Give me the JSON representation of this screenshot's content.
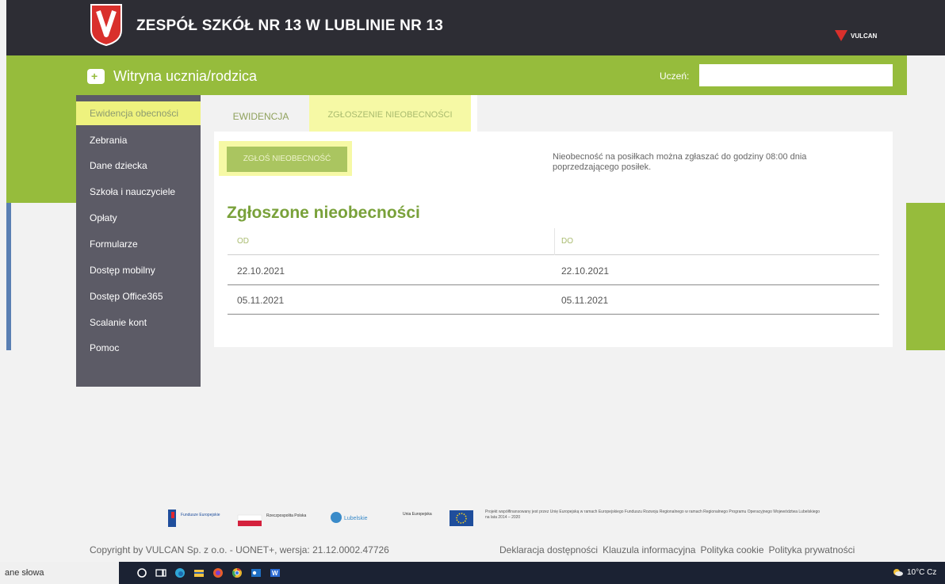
{
  "header": {
    "school_name": "ZESPÓŁ SZKÓŁ NR 13 W LUBLINIE NR 13",
    "vulcan_label": "VULCAN",
    "portal_title": "Witryna ucznia/rodzica",
    "student_label": "Uczeń:",
    "student_value": ""
  },
  "sidebar": {
    "items": [
      {
        "label": "Ewidencja obecności"
      },
      {
        "label": "Zebrania"
      },
      {
        "label": "Dane dziecka"
      },
      {
        "label": "Szkoła i nauczyciele"
      },
      {
        "label": "Opłaty"
      },
      {
        "label": "Formularze"
      },
      {
        "label": "Dostęp mobilny"
      },
      {
        "label": "Dostęp Office365"
      },
      {
        "label": "Scalanie kont"
      },
      {
        "label": "Pomoc"
      }
    ]
  },
  "tabs": [
    {
      "label": "EWIDENCJA"
    },
    {
      "label": "ZGŁOSZENIE NIEOBECNOŚCI"
    }
  ],
  "main": {
    "report_button": "ZGŁOŚ NIEOBECNOŚĆ",
    "meal_info": "Nieobecność na posiłkach można zgłaszać do godziny 08:00 dnia poprzedzającego posiłek.",
    "list_title": "Zgłoszone nieobecności",
    "table": {
      "headers": [
        "OD",
        "DO"
      ],
      "rows": [
        [
          "22.10.2021",
          "22.10.2021"
        ],
        [
          "05.11.2021",
          "05.11.2021"
        ]
      ]
    }
  },
  "footer": {
    "logos": {
      "fe": "Fundusze Europejskie",
      "rp": "Rzeczpospolita Polska",
      "lubelskie": "Lubelskie",
      "ue": "Unia Europejska"
    },
    "project_note": "Projekt współfinansowany jest przez Unię Europejską w ramach Europejskiego Funduszu Rozwoju Regionalnego w ramach Regionalnego Programu Operacyjnego Województwa Lubelskiego na lata 2014 – 2020",
    "copyright": "Copyright by VULCAN Sp. z o.o. - UONET+, wersja: 21.12.0002.47726",
    "links": [
      "Deklaracja dostępności",
      "Klauzula informacyjna",
      "Polityka cookie",
      "Polityka prywatności"
    ]
  },
  "taskbar": {
    "search_text": "ane słowa",
    "weather": "10°C Cz"
  },
  "colors": {
    "brand_green": "#96bc3c",
    "header_dark": "#2d2d34",
    "sidebar_gray": "#5c5b66",
    "highlight_yellow": "#f6f9a5"
  }
}
